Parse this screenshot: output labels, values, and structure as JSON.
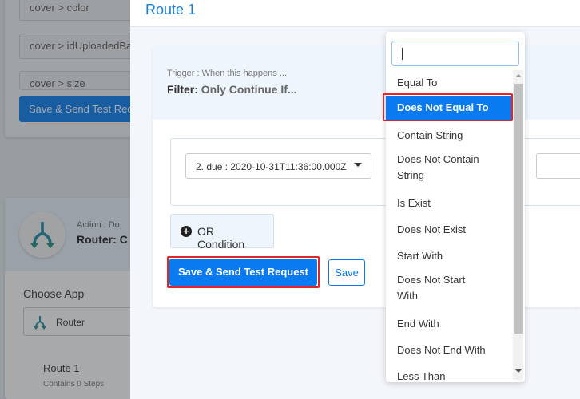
{
  "background": {
    "fields": [
      "cover > color",
      "cover > idUploadedBackground",
      "cover > size"
    ],
    "save_test_label": "Save & Send Test Request",
    "action_label": "Action : Do",
    "action_title": "Router: C",
    "choose_app_label": "Choose App",
    "app_value": "Router",
    "route_name": "Route 1",
    "route_steps": "Contains 0 Steps"
  },
  "panel": {
    "title": "Route 1",
    "trigger_label": "Trigger : When this happens ...",
    "filter_label": "Filter:",
    "filter_text": "Only Continue If...",
    "field_select_value": "2. due : 2020-10-31T11:36:00.000Z",
    "or_condition_label": "OR Condition",
    "save_test_label": "Save & Send Test Request",
    "save_label": "Save"
  },
  "dropdown": {
    "search_value": "",
    "selected": "Does Not Equal To",
    "options": [
      "Equal To",
      "Does Not Equal To",
      "Contain String",
      "Does Not Contain String",
      "Is Exist",
      "Does Not Exist",
      "Start With",
      "Does Not Start With",
      "End With",
      "Does Not End With",
      "Less Than"
    ]
  },
  "colors": {
    "accent": "#0a7af0",
    "highlight_outline": "#e0262b",
    "title": "#1a7fd8"
  }
}
